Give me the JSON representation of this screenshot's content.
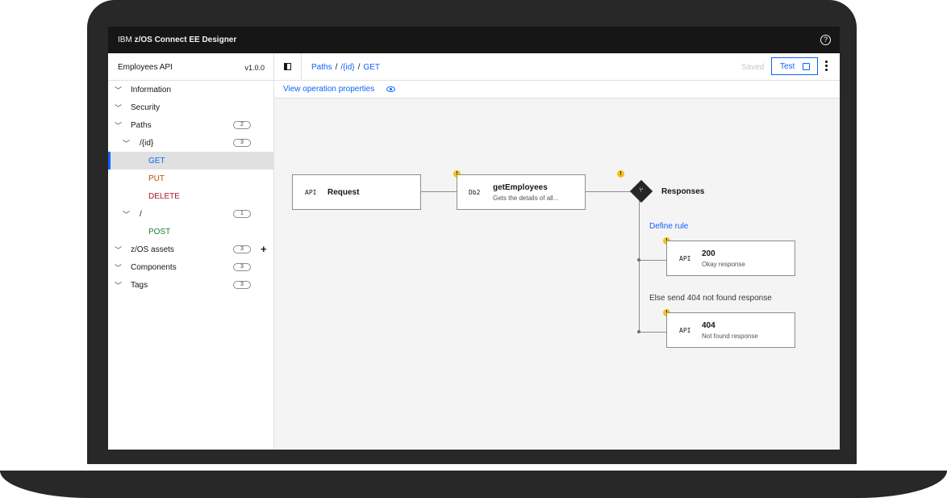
{
  "app": {
    "brand_prefix": "IBM ",
    "brand_name": "z/OS Connect EE Designer",
    "help_icon": "help-icon"
  },
  "sidebar": {
    "api_name": "Employees API",
    "api_version": "v1.0.0",
    "items": [
      {
        "label": "Information"
      },
      {
        "label": "Security"
      },
      {
        "label": "Paths",
        "count": "2"
      },
      {
        "label": "/{id}",
        "count": "3"
      },
      {
        "label": "GET"
      },
      {
        "label": "PUT"
      },
      {
        "label": "DELETE"
      },
      {
        "label": "/",
        "count": "1"
      },
      {
        "label": "POST"
      },
      {
        "label": "z/OS assets",
        "count": "3",
        "add": "+"
      },
      {
        "label": "Components",
        "count": "3"
      },
      {
        "label": "Tags",
        "count": "3"
      }
    ],
    "method_colors": {
      "GET": "#0f62fe",
      "PUT": "#ba4e00",
      "DELETE": "#a2191f",
      "POST": "#198038"
    }
  },
  "header": {
    "breadcrumb": [
      "Paths",
      "/{id}",
      "GET"
    ],
    "separator": "/",
    "saved_label": "Saved",
    "test_label": "Test"
  },
  "properties": {
    "link_label": "View operation properties"
  },
  "flow": {
    "request": {
      "tag": "API",
      "title": "Request"
    },
    "operation": {
      "tag": "Db2",
      "title": "getEmployees",
      "subtitle": "Gets the details of all..."
    },
    "warning_mark": "!",
    "responses_label": "Responses",
    "define_rule_label": "Define rule",
    "response_200": {
      "tag": "API",
      "title": "200",
      "subtitle": "Okay response"
    },
    "else_label": "Else send 404 not found response",
    "response_404": {
      "tag": "API",
      "title": "404",
      "subtitle": "Not found response"
    }
  }
}
